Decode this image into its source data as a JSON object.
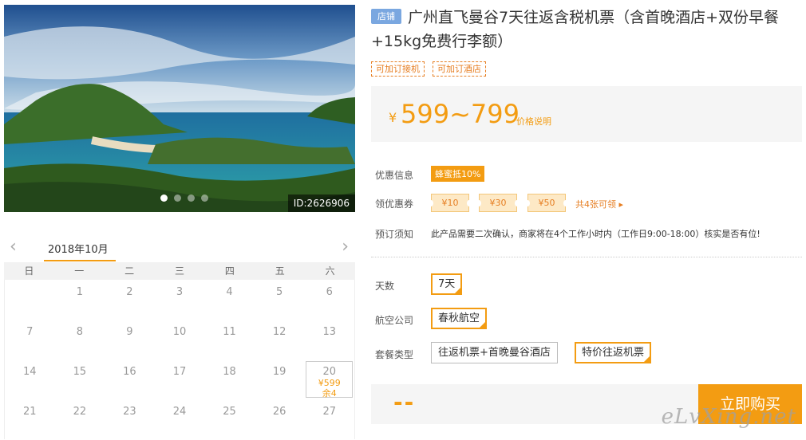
{
  "gallery": {
    "photo_id": "ID:2626906",
    "slides": 4,
    "active_slide": 1
  },
  "calendar": {
    "month_label": "2018年10月",
    "weekdays": [
      "日",
      "一",
      "二",
      "三",
      "四",
      "五",
      "六"
    ],
    "rows": [
      [
        {
          "d": ""
        },
        {
          "d": "1"
        },
        {
          "d": "2"
        },
        {
          "d": "3"
        },
        {
          "d": "4"
        },
        {
          "d": "5"
        },
        {
          "d": "6"
        }
      ],
      [
        {
          "d": "7"
        },
        {
          "d": "8"
        },
        {
          "d": "9"
        },
        {
          "d": "10"
        },
        {
          "d": "11"
        },
        {
          "d": "12"
        },
        {
          "d": "13"
        }
      ],
      [
        {
          "d": "14"
        },
        {
          "d": "15"
        },
        {
          "d": "16"
        },
        {
          "d": "17"
        },
        {
          "d": "18"
        },
        {
          "d": "19"
        },
        {
          "d": "20",
          "price": "¥599",
          "stock": "余4"
        }
      ],
      [
        {
          "d": "21"
        },
        {
          "d": "22"
        },
        {
          "d": "23"
        },
        {
          "d": "24"
        },
        {
          "d": "25"
        },
        {
          "d": "26"
        },
        {
          "d": "27"
        }
      ]
    ]
  },
  "product": {
    "shop_badge": "店铺",
    "title": "广州直飞曼谷7天往返含税机票（含首晚酒店+双份早餐+15kg免费行李额）",
    "tags": [
      "可加订接机",
      "可加订酒店"
    ],
    "price_symbol": "¥",
    "price_range": "599~799",
    "price_note": "价格说明"
  },
  "promo": {
    "label": "优惠信息",
    "badge": "蜂蜜抵10%"
  },
  "coupons": {
    "label": "领优惠券",
    "items": [
      "¥10",
      "¥30",
      "¥50"
    ],
    "more": "共4张可领 ▸"
  },
  "booking": {
    "label": "预订须知",
    "text": "此产品需要二次确认，商家将在4个工作小时内（工作日9:00-18:00）核实是否有位!"
  },
  "options": {
    "days_label": "天数",
    "days_value": "7天",
    "airline_label": "航空公司",
    "airline_value": "春秋航空",
    "package_label": "套餐类型",
    "package_a": "往返机票+首晚曼谷酒店",
    "package_b": "特价往返机票"
  },
  "buy": {
    "price_placeholder": "--",
    "button": "立即购买"
  },
  "watermark": "eLvXing.net",
  "colors": {
    "accent": "#f39c12",
    "badge": "#7aa7e0"
  }
}
